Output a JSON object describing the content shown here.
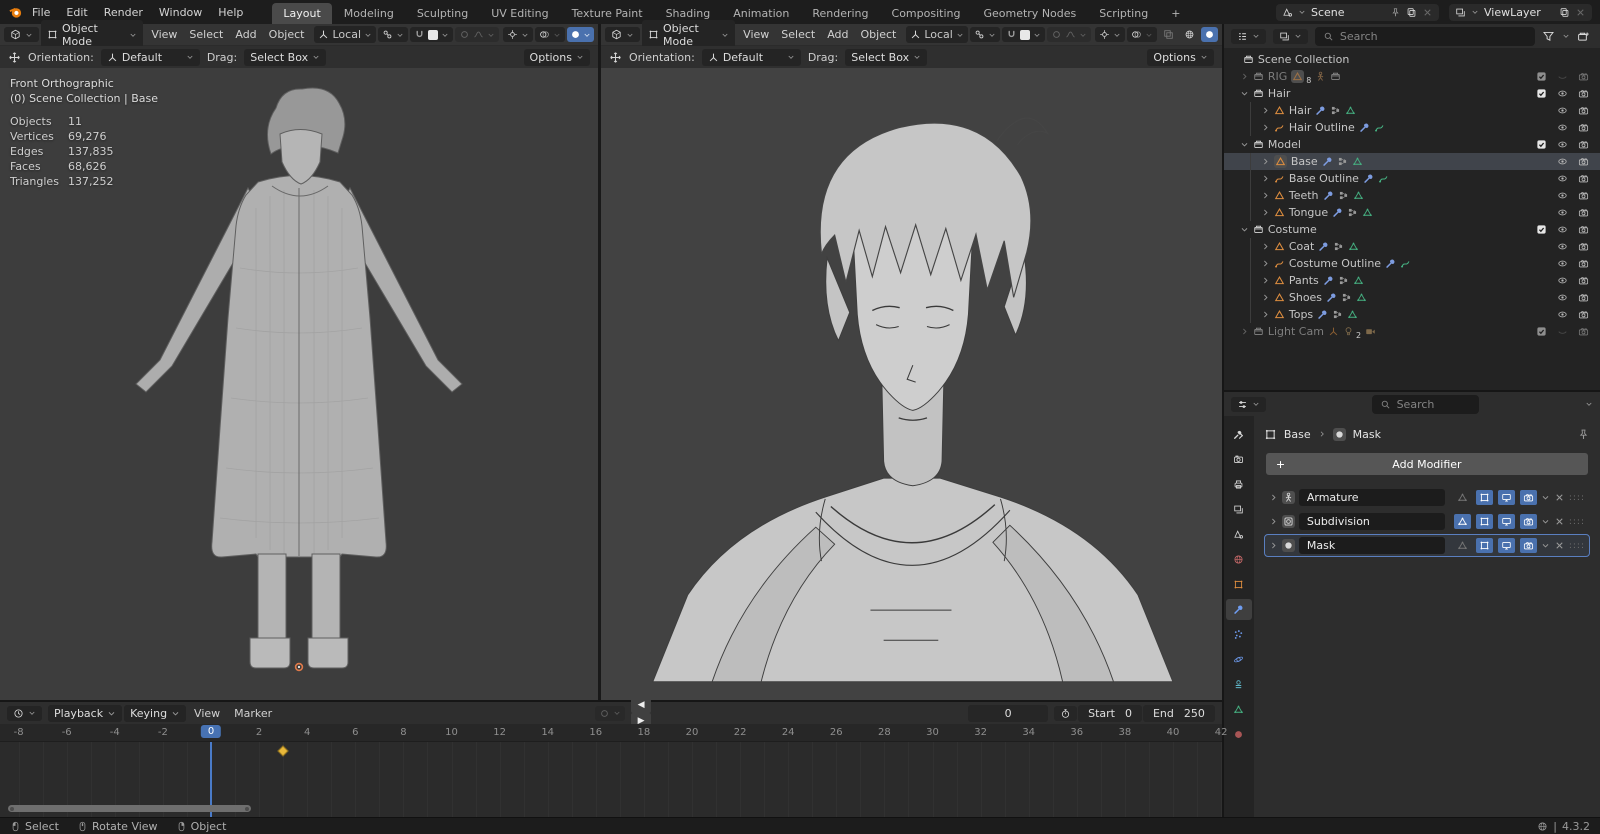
{
  "topbar": {
    "menus": [
      "File",
      "Edit",
      "Render",
      "Window",
      "Help"
    ],
    "tabs": [
      {
        "label": "Layout",
        "active": true
      },
      {
        "label": "Modeling"
      },
      {
        "label": "Sculpting"
      },
      {
        "label": "UV Editing"
      },
      {
        "label": "Texture Paint"
      },
      {
        "label": "Shading"
      },
      {
        "label": "Animation"
      },
      {
        "label": "Rendering"
      },
      {
        "label": "Compositing"
      },
      {
        "label": "Geometry Nodes"
      },
      {
        "label": "Scripting"
      },
      {
        "label": "+"
      }
    ],
    "scene": "Scene",
    "view_layer": "ViewLayer"
  },
  "viewports": {
    "left": {
      "mode": "Object Mode",
      "menus": [
        "View",
        "Select",
        "Add",
        "Object"
      ],
      "transform_orientation": "Local",
      "orientation_label": "Orientation:",
      "orientation": "Default",
      "drag_label": "Drag:",
      "drag": "Select Box",
      "options": "Options",
      "overlay": {
        "view": "Front Orthographic",
        "context": "(0) Scene Collection | Base",
        "stats": [
          {
            "label": "Objects",
            "value": "11"
          },
          {
            "label": "Vertices",
            "value": "69,276"
          },
          {
            "label": "Edges",
            "value": "137,835"
          },
          {
            "label": "Faces",
            "value": "68,626"
          },
          {
            "label": "Triangles",
            "value": "137,252"
          }
        ]
      }
    },
    "right": {
      "mode": "Object Mode",
      "menus": [
        "View",
        "Select",
        "Add",
        "Object"
      ],
      "transform_orientation": "Local",
      "orientation_label": "Orientation:",
      "orientation": "Default",
      "drag_label": "Drag:",
      "drag": "Select Box",
      "options": "Options"
    }
  },
  "outliner": {
    "search_placeholder": "Search",
    "rows": [
      {
        "label": "Scene Collection",
        "icon": "collection",
        "depth": 0,
        "extras": [],
        "right": []
      },
      {
        "label": "RIG",
        "icon": "collection",
        "depth": 1,
        "expand": "right",
        "grayed": true,
        "extras": [
          "mesh8",
          "armature",
          "collection"
        ],
        "right": [
          "check",
          "eye-closed",
          "camera"
        ]
      },
      {
        "label": "Hair",
        "icon": "collection",
        "depth": 1,
        "expand": "down",
        "extras": [],
        "right": [
          "check",
          "eye",
          "camera"
        ]
      },
      {
        "label": "Hair",
        "icon": "mesh",
        "depth": 2,
        "expand": "right",
        "extras": [
          "wrench",
          "vgroup",
          "datamesh"
        ],
        "right": [
          "eye",
          "camera"
        ]
      },
      {
        "label": "Hair Outline",
        "icon": "curve",
        "depth": 2,
        "expand": "right",
        "extras": [
          "wrench",
          "datacurve"
        ],
        "right": [
          "eye",
          "camera"
        ]
      },
      {
        "label": "Model",
        "icon": "collection",
        "depth": 1,
        "expand": "down",
        "extras": [],
        "right": [
          "check",
          "eye",
          "camera"
        ]
      },
      {
        "label": "Base",
        "icon": "mesh",
        "depth": 2,
        "expand": "right",
        "selected": true,
        "boxed": true,
        "extras": [
          "wrench",
          "vgroup",
          "datamesh"
        ],
        "right": [
          "eye",
          "camera"
        ]
      },
      {
        "label": "Base Outline",
        "icon": "curve",
        "depth": 2,
        "expand": "right",
        "extras": [
          "wrench",
          "datacurve"
        ],
        "right": [
          "eye",
          "camera"
        ]
      },
      {
        "label": "Teeth",
        "icon": "mesh",
        "depth": 2,
        "expand": "right",
        "extras": [
          "wrench",
          "vgroup",
          "datamesh"
        ],
        "right": [
          "eye",
          "camera"
        ]
      },
      {
        "label": "Tongue",
        "icon": "mesh",
        "depth": 2,
        "expand": "right",
        "extras": [
          "wrench",
          "vgroup",
          "datamesh"
        ],
        "right": [
          "eye",
          "camera"
        ]
      },
      {
        "label": "Costume",
        "icon": "collection",
        "depth": 1,
        "expand": "down",
        "extras": [],
        "right": [
          "check",
          "eye",
          "camera"
        ]
      },
      {
        "label": "Coat",
        "icon": "mesh",
        "depth": 2,
        "expand": "right",
        "extras": [
          "wrench",
          "vgroup",
          "datamesh"
        ],
        "right": [
          "eye",
          "camera"
        ]
      },
      {
        "label": "Costume Outline",
        "icon": "curve",
        "depth": 2,
        "expand": "right",
        "extras": [
          "wrench",
          "datacurve"
        ],
        "right": [
          "eye",
          "camera"
        ]
      },
      {
        "label": "Pants",
        "icon": "mesh",
        "depth": 2,
        "expand": "right",
        "extras": [
          "wrench",
          "vgroup",
          "datamesh"
        ],
        "right": [
          "eye",
          "camera"
        ]
      },
      {
        "label": "Shoes",
        "icon": "mesh",
        "depth": 2,
        "expand": "right",
        "extras": [
          "wrench",
          "vgroup",
          "datamesh"
        ],
        "right": [
          "eye",
          "camera"
        ]
      },
      {
        "label": "Tops",
        "icon": "mesh",
        "depth": 2,
        "expand": "right",
        "extras": [
          "wrench",
          "vgroup",
          "datamesh"
        ],
        "right": [
          "eye",
          "camera"
        ]
      },
      {
        "label": "Light Cam",
        "icon": "collection",
        "depth": 1,
        "expand": "right",
        "grayed": true,
        "extras": [
          "empty",
          "bulb2",
          "camobj"
        ],
        "right": [
          "check",
          "eye-closed",
          "camera"
        ]
      }
    ]
  },
  "properties": {
    "search_placeholder": "Search",
    "breadcrumb": [
      "Base",
      "Mask"
    ],
    "add_modifier_label": "Add Modifier",
    "tabs": [
      {
        "name": "tool",
        "icon": "wrenchdriver",
        "color": "c-white"
      },
      {
        "name": "render",
        "icon": "camback",
        "color": "c-white"
      },
      {
        "name": "output",
        "icon": "printer",
        "color": "c-white"
      },
      {
        "name": "view-layer",
        "icon": "images",
        "color": "c-white"
      },
      {
        "name": "scene",
        "icon": "cone",
        "color": "c-white"
      },
      {
        "name": "world",
        "icon": "globe",
        "color": "c-red"
      },
      {
        "name": "object",
        "icon": "objsquare",
        "color": "c-mesh"
      },
      {
        "name": "modifiers",
        "icon": "wrench",
        "color": "c-blue",
        "active": true
      },
      {
        "name": "particles",
        "icon": "particles",
        "color": "c-blue"
      },
      {
        "name": "physics",
        "icon": "orbit",
        "color": "c-blue"
      },
      {
        "name": "constraints",
        "icon": "constraint",
        "color": "c-cyan"
      },
      {
        "name": "object-data",
        "icon": "datamesh",
        "color": "c-green"
      },
      {
        "name": "material",
        "icon": "sphere",
        "color": "c-maroon"
      }
    ],
    "modifiers": [
      {
        "name": "Armature",
        "icon": "armature",
        "toggles": [
          false,
          true,
          true,
          true
        ]
      },
      {
        "name": "Subdivision",
        "icon": "subdiv",
        "toggles": [
          true,
          true,
          true,
          true
        ]
      },
      {
        "name": "Mask",
        "icon": "mask",
        "toggles": [
          false,
          true,
          true,
          true
        ],
        "active": true
      }
    ]
  },
  "timeline": {
    "menus": [
      "Playback",
      "Keying",
      "View",
      "Marker"
    ],
    "ruler": [
      -8,
      -6,
      -4,
      -2,
      0,
      2,
      4,
      6,
      8,
      10,
      12,
      14,
      16,
      18,
      20,
      22,
      24,
      26,
      28,
      30,
      32,
      34,
      36,
      38,
      40,
      42
    ],
    "current_frame": "0",
    "keyframe_frames": [
      3
    ],
    "start_label": "Start",
    "start": "0",
    "end_label": "End",
    "end": "250"
  },
  "statusbar": {
    "hints": [
      {
        "button": "left",
        "label": "Select"
      },
      {
        "button": "middle",
        "label": "Rotate View"
      },
      {
        "button": "right",
        "label": "Object"
      }
    ],
    "version": "4.3.2"
  },
  "colors": {
    "accent_blue": "#4772b3",
    "mesh_orange": "#dd8d3f",
    "data_green": "#46b383",
    "modifier_blue": "#6f9df1",
    "keyframe_yellow": "#e9b83a"
  }
}
